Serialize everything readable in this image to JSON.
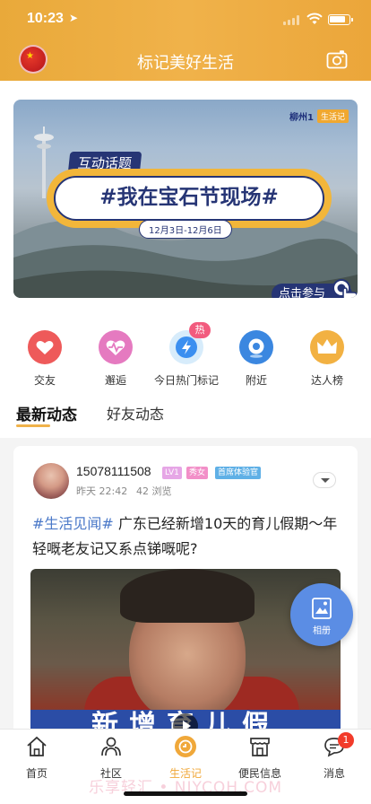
{
  "status_bar": {
    "time": "10:23",
    "location_arrow": "➤"
  },
  "header": {
    "title": "标记美好生活",
    "avatar_icon": "china-flag-avatar",
    "camera_icon": "camera-icon"
  },
  "banner": {
    "brand_name": "柳州1",
    "brand_tag": "生活记",
    "topic_label": "互动话题",
    "topic_title": "#我在宝石节现场#",
    "date_range": "12月3日-12月6日",
    "join_button": "点击参与"
  },
  "shortcuts": [
    {
      "label": "交友",
      "icon": "heart-icon",
      "color": "#ee5a5a"
    },
    {
      "label": "邂逅",
      "icon": "heartbeat-icon",
      "color": "#e57ac0"
    },
    {
      "label": "今日热门标记",
      "icon": "lightning-icon",
      "color": "#3b8ff0",
      "badge": "热"
    },
    {
      "label": "附近",
      "icon": "location-icon",
      "color": "#3b87e0"
    },
    {
      "label": "达人榜",
      "icon": "crown-icon",
      "color": "#f2b142"
    }
  ],
  "tabs": [
    {
      "label": "最新动态",
      "active": true
    },
    {
      "label": "好友动态",
      "active": false
    }
  ],
  "post": {
    "username": "15078111508",
    "chips": [
      {
        "text": "LV1",
        "color": "#e6a6e6"
      },
      {
        "text": "秀女",
        "color": "#f28fc8"
      },
      {
        "text": "首席体验官",
        "color": "#5fb0e6"
      }
    ],
    "time": "昨天 22:42",
    "views": "42 浏览",
    "topic": "#生活见闻#",
    "text": " 广东已经新增10天的育儿假期～年轻嘅老友记又系点锑嘅呢?",
    "image_caption": "新增育儿假"
  },
  "album_fab": {
    "label": "相册",
    "icon": "photo-album-icon"
  },
  "tabbar": [
    {
      "label": "首页",
      "icon": "home-icon",
      "active": false
    },
    {
      "label": "社区",
      "icon": "community-icon",
      "active": false
    },
    {
      "label": "生活记",
      "icon": "life-log-icon",
      "active": true
    },
    {
      "label": "便民信息",
      "icon": "store-icon",
      "active": false
    },
    {
      "label": "消息",
      "icon": "message-icon",
      "active": false,
      "badge": "1"
    }
  ],
  "watermark": "乐享轻汇 • NJYCOH.COM",
  "colors": {
    "accent": "#f0b24a",
    "topic_blue": "#4a78c8",
    "banner_navy": "#263575"
  }
}
